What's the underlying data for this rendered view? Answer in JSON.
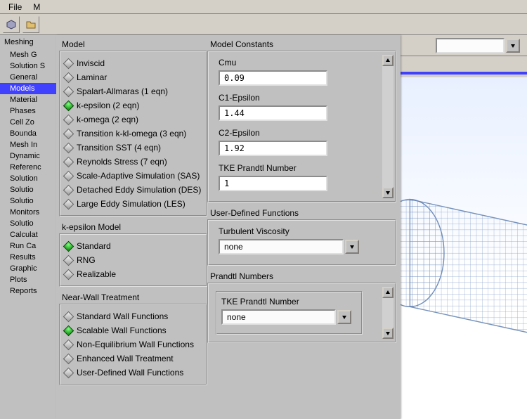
{
  "menu": {
    "file": "File",
    "m": "M"
  },
  "tree": {
    "header": "Meshing",
    "items": [
      {
        "label": "Mesh G",
        "sel": false
      },
      {
        "label": "Solution S",
        "sel": false
      },
      {
        "label": "General",
        "sel": false
      },
      {
        "label": "Models",
        "sel": true
      },
      {
        "label": "Material",
        "sel": false
      },
      {
        "label": "Phases",
        "sel": false
      },
      {
        "label": "Cell Zo",
        "sel": false
      },
      {
        "label": "Bounda",
        "sel": false
      },
      {
        "label": "Mesh In",
        "sel": false
      },
      {
        "label": "Dynamic",
        "sel": false
      },
      {
        "label": "Referenc",
        "sel": false
      },
      {
        "label": "Solution",
        "sel": false
      },
      {
        "label": "Solutio",
        "sel": false
      },
      {
        "label": "Solutio",
        "sel": false
      },
      {
        "label": "Monitors",
        "sel": false
      },
      {
        "label": "Solutio",
        "sel": false
      },
      {
        "label": "Calculat",
        "sel": false
      },
      {
        "label": "Run Ca",
        "sel": false
      },
      {
        "label": "Results",
        "sel": false
      },
      {
        "label": "Graphic",
        "sel": false
      },
      {
        "label": "Plots",
        "sel": false
      },
      {
        "label": "Reports",
        "sel": false
      }
    ]
  },
  "model": {
    "title": "Model",
    "options": [
      {
        "label": "Inviscid",
        "sel": false
      },
      {
        "label": "Laminar",
        "sel": false
      },
      {
        "label": "Spalart-Allmaras (1 eqn)",
        "sel": false
      },
      {
        "label": "k-epsilon (2 eqn)",
        "sel": true
      },
      {
        "label": "k-omega (2 eqn)",
        "sel": false
      },
      {
        "label": "Transition k-kl-omega (3 eqn)",
        "sel": false
      },
      {
        "label": "Transition SST (4 eqn)",
        "sel": false
      },
      {
        "label": "Reynolds Stress (7 eqn)",
        "sel": false
      },
      {
        "label": "Scale-Adaptive Simulation (SAS)",
        "sel": false
      },
      {
        "label": "Detached Eddy Simulation (DES)",
        "sel": false
      },
      {
        "label": "Large Eddy Simulation (LES)",
        "sel": false
      }
    ]
  },
  "ke_model": {
    "title": "k-epsilon Model",
    "options": [
      {
        "label": "Standard",
        "sel": true
      },
      {
        "label": "RNG",
        "sel": false
      },
      {
        "label": "Realizable",
        "sel": false
      }
    ]
  },
  "near_wall": {
    "title": "Near-Wall Treatment",
    "options": [
      {
        "label": "Standard Wall Functions",
        "sel": false
      },
      {
        "label": "Scalable Wall Functions",
        "sel": true
      },
      {
        "label": "Non-Equilibrium Wall Functions",
        "sel": false
      },
      {
        "label": "Enhanced Wall Treatment",
        "sel": false
      },
      {
        "label": "User-Defined Wall Functions",
        "sel": false
      }
    ]
  },
  "constants": {
    "title": "Model Constants",
    "cmu": {
      "label": "Cmu",
      "value": "0.09"
    },
    "c1e": {
      "label": "C1-Epsilon",
      "value": "1.44"
    },
    "c2e": {
      "label": "C2-Epsilon",
      "value": "1.92"
    },
    "tke": {
      "label": "TKE Prandtl Number",
      "value": "1"
    }
  },
  "udf": {
    "title": "User-Defined Functions",
    "turb_visc": {
      "label": "Turbulent Viscosity",
      "value": "none"
    },
    "prandtl_title": "Prandtl Numbers",
    "tke_prandtl": {
      "label": "TKE Prandtl Number",
      "value": "none"
    }
  }
}
